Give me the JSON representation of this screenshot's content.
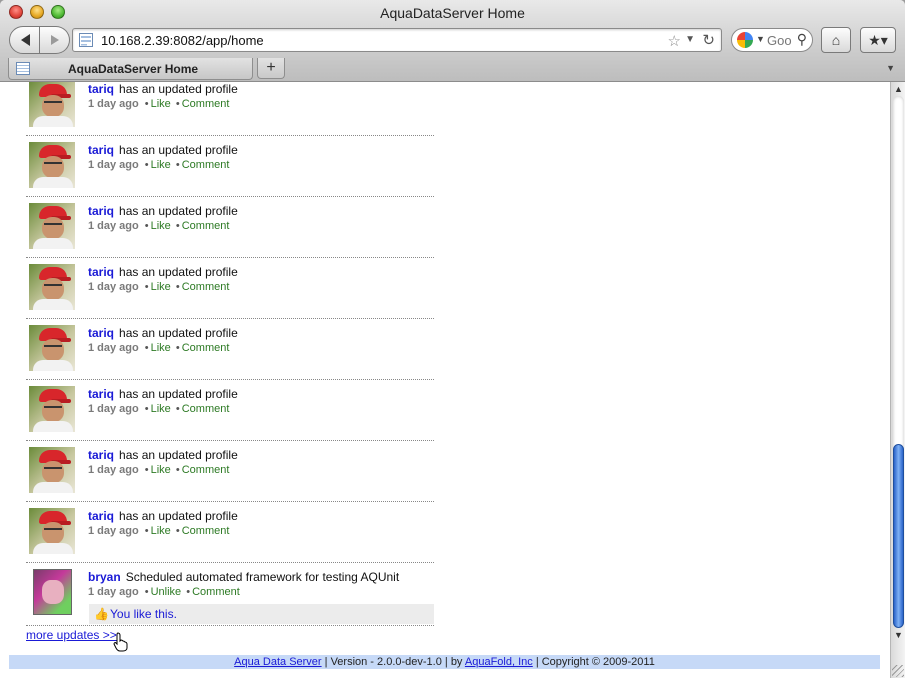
{
  "window": {
    "title": "AquaDataServer Home"
  },
  "toolbar": {
    "url": "10.168.2.39:8082/app/home",
    "search_placeholder": "Goo"
  },
  "tabs": [
    {
      "label": "AquaDataServer Home"
    }
  ],
  "feed": {
    "items": [
      {
        "user": "tariq",
        "text": "has an updated profile",
        "time": "1 day ago",
        "action1": "Like",
        "action2": "Comment"
      },
      {
        "user": "tariq",
        "text": "has an updated profile",
        "time": "1 day ago",
        "action1": "Like",
        "action2": "Comment"
      },
      {
        "user": "tariq",
        "text": "has an updated profile",
        "time": "1 day ago",
        "action1": "Like",
        "action2": "Comment"
      },
      {
        "user": "tariq",
        "text": "has an updated profile",
        "time": "1 day ago",
        "action1": "Like",
        "action2": "Comment"
      },
      {
        "user": "tariq",
        "text": "has an updated profile",
        "time": "1 day ago",
        "action1": "Like",
        "action2": "Comment"
      },
      {
        "user": "tariq",
        "text": "has an updated profile",
        "time": "1 day ago",
        "action1": "Like",
        "action2": "Comment"
      },
      {
        "user": "tariq",
        "text": "has an updated profile",
        "time": "1 day ago",
        "action1": "Like",
        "action2": "Comment"
      },
      {
        "user": "tariq",
        "text": "has an updated profile",
        "time": "1 day ago",
        "action1": "Like",
        "action2": "Comment"
      }
    ],
    "bryan": {
      "user": "bryan",
      "text": "Scheduled automated framework for testing AQUnit",
      "time": "1 day ago",
      "action1": "Unlike",
      "action2": "Comment",
      "like_text": "You like this."
    },
    "separator": "•",
    "more_link": "more updates >>"
  },
  "footer": {
    "product_link": "Aqua Data Server",
    "version_text": " | Version - 2.0.0-dev-1.0 | by ",
    "company_link": "AquaFold, Inc",
    "copyright_text": " | Copyright © 2009-2011"
  },
  "icons": {
    "back": "back-arrow-icon",
    "forward": "forward-arrow-icon",
    "bookmark_star": "star-icon",
    "reload": "reload-icon",
    "home": "home-icon",
    "bookmarks": "bookmarks-icon"
  },
  "colors": {
    "link_blue": "#1a1ad6",
    "action_green": "#2d7a24",
    "footer_bg": "#c6d9f7",
    "scroll_thumb": "#2a63c9"
  },
  "scroll": {
    "position_fraction": 1.0
  }
}
